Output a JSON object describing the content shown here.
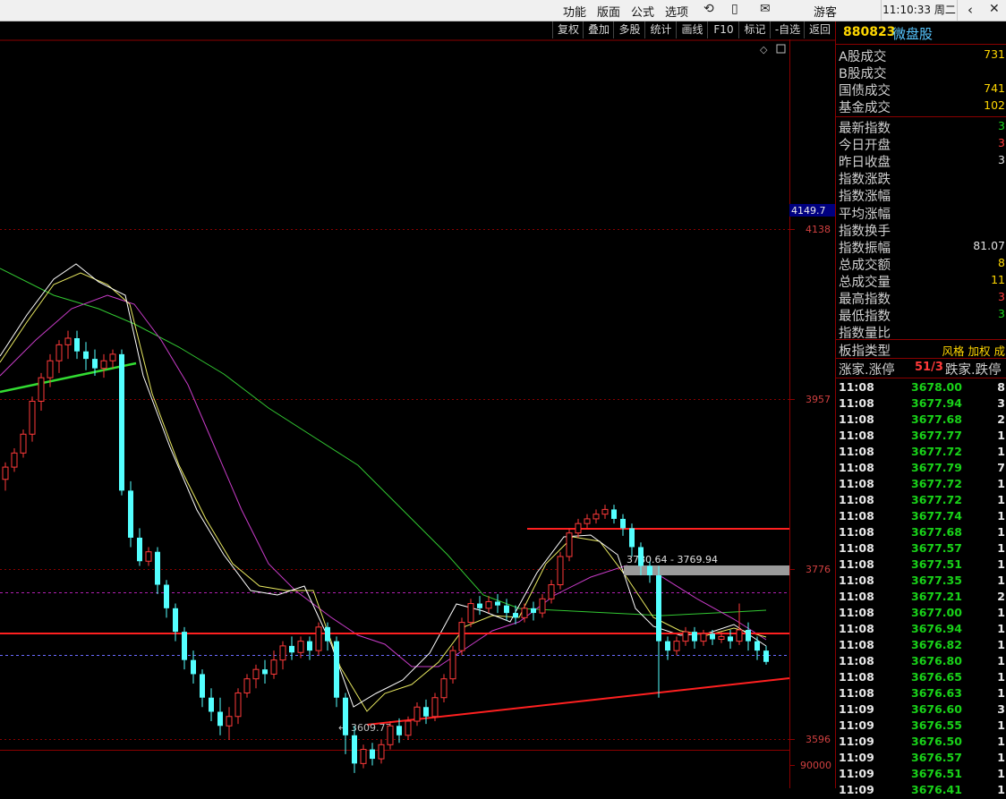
{
  "menu": {
    "items": [
      "功能",
      "版面",
      "公式",
      "选项"
    ],
    "user": "游客",
    "clock": "11:10:33 周二"
  },
  "toolbar": {
    "buttons": [
      "复权",
      "叠加",
      "多股",
      "统计",
      "画线",
      "F10",
      "标记",
      "-自选",
      "返回"
    ]
  },
  "chart_data": {
    "type": "candlestick",
    "y_ticks": [
      "4138",
      "3957",
      "3776",
      "3596"
    ],
    "volume_tick": "90000",
    "price_tag": "4149.7",
    "annotations": {
      "range_label": "3780.64 - 3769.94",
      "low_label": "3609.77"
    },
    "candles": [
      [
        3872,
        3885,
        3860,
        3890
      ],
      [
        3885,
        3900,
        3880,
        3905
      ],
      [
        3900,
        3920,
        3895,
        3925
      ],
      [
        3920,
        3955,
        3912,
        3960
      ],
      [
        3955,
        3980,
        3945,
        3985
      ],
      [
        3980,
        3998,
        3970,
        4005
      ],
      [
        3998,
        4015,
        3985,
        4020
      ],
      [
        4015,
        4022,
        4000,
        4030
      ],
      [
        4022,
        4008,
        4000,
        4030
      ],
      [
        4008,
        4000,
        3988,
        4018
      ],
      [
        4000,
        3990,
        3982,
        4010
      ],
      [
        3990,
        3998,
        3980,
        4005
      ],
      [
        3998,
        4005,
        3990,
        4010
      ],
      [
        4005,
        3860,
        3855,
        4010
      ],
      [
        3860,
        3810,
        3800,
        3870
      ],
      [
        3810,
        3785,
        3780,
        3820
      ],
      [
        3785,
        3795,
        3780,
        3800
      ],
      [
        3795,
        3760,
        3750,
        3800
      ],
      [
        3760,
        3735,
        3725,
        3765
      ],
      [
        3735,
        3710,
        3700,
        3740
      ],
      [
        3710,
        3680,
        3670,
        3715
      ],
      [
        3680,
        3665,
        3655,
        3690
      ],
      [
        3665,
        3640,
        3630,
        3670
      ],
      [
        3640,
        3625,
        3615,
        3650
      ],
      [
        3625,
        3610,
        3600,
        3640
      ],
      [
        3610,
        3620,
        3595,
        3630
      ],
      [
        3620,
        3645,
        3612,
        3650
      ],
      [
        3645,
        3660,
        3640,
        3665
      ],
      [
        3660,
        3670,
        3650,
        3675
      ],
      [
        3670,
        3665,
        3655,
        3680
      ],
      [
        3665,
        3680,
        3660,
        3690
      ],
      [
        3680,
        3695,
        3670,
        3700
      ],
      [
        3695,
        3688,
        3680,
        3705
      ],
      [
        3688,
        3700,
        3682,
        3705
      ],
      [
        3700,
        3690,
        3680,
        3705
      ],
      [
        3690,
        3715,
        3685,
        3720
      ],
      [
        3715,
        3700,
        3690,
        3720
      ],
      [
        3700,
        3640,
        3630,
        3705
      ],
      [
        3640,
        3600,
        3580,
        3645
      ],
      [
        3600,
        3570,
        3560,
        3610
      ],
      [
        3570,
        3585,
        3565,
        3590
      ],
      [
        3585,
        3575,
        3568,
        3592
      ],
      [
        3575,
        3590,
        3570,
        3595
      ],
      [
        3590,
        3610,
        3585,
        3615
      ],
      [
        3610,
        3600,
        3592,
        3618
      ],
      [
        3600,
        3615,
        3595,
        3620
      ],
      [
        3615,
        3630,
        3610,
        3635
      ],
      [
        3630,
        3620,
        3612,
        3638
      ],
      [
        3620,
        3640,
        3615,
        3645
      ],
      [
        3640,
        3660,
        3635,
        3665
      ],
      [
        3660,
        3690,
        3655,
        3695
      ],
      [
        3690,
        3720,
        3685,
        3725
      ],
      [
        3720,
        3740,
        3715,
        3745
      ],
      [
        3740,
        3735,
        3728,
        3748
      ],
      [
        3735,
        3742,
        3730,
        3748
      ],
      [
        3742,
        3738,
        3730,
        3750
      ],
      [
        3738,
        3730,
        3722,
        3745
      ],
      [
        3730,
        3725,
        3718,
        3738
      ],
      [
        3725,
        3735,
        3720,
        3740
      ],
      [
        3735,
        3730,
        3722,
        3742
      ],
      [
        3730,
        3745,
        3725,
        3750
      ],
      [
        3745,
        3760,
        3740,
        3765
      ],
      [
        3760,
        3790,
        3755,
        3795
      ],
      [
        3790,
        3815,
        3785,
        3820
      ],
      [
        3815,
        3825,
        3810,
        3830
      ],
      [
        3825,
        3830,
        3820,
        3835
      ],
      [
        3830,
        3835,
        3825,
        3840
      ],
      [
        3835,
        3840,
        3830,
        3845
      ],
      [
        3840,
        3830,
        3825,
        3845
      ],
      [
        3830,
        3820,
        3812,
        3835
      ],
      [
        3820,
        3800,
        3790,
        3825
      ],
      [
        3800,
        3780,
        3770,
        3805
      ],
      [
        3780,
        3770,
        3762,
        3785
      ],
      [
        3770,
        3700,
        3640,
        3780
      ],
      [
        3700,
        3690,
        3680,
        3705
      ],
      [
        3690,
        3700,
        3685,
        3705
      ],
      [
        3700,
        3710,
        3695,
        3715
      ],
      [
        3710,
        3700,
        3692,
        3715
      ],
      [
        3700,
        3708,
        3695,
        3712
      ],
      [
        3708,
        3702,
        3696,
        3712
      ],
      [
        3702,
        3705,
        3698,
        3710
      ],
      [
        3705,
        3700,
        3692,
        3712
      ],
      [
        3700,
        3712,
        3696,
        3740
      ],
      [
        3712,
        3700,
        3690,
        3720
      ],
      [
        3700,
        3690,
        3680,
        3705
      ],
      [
        3690,
        3678,
        3675,
        3695
      ]
    ]
  },
  "panel": {
    "code": "880823",
    "name": "微盘股",
    "stats1": [
      {
        "label": "A股成交",
        "value": "731",
        "color": "#ffd700"
      },
      {
        "label": "B股成交",
        "value": "",
        "color": "#ffd700"
      },
      {
        "label": "国债成交",
        "value": "741",
        "color": "#ffd700"
      },
      {
        "label": "基金成交",
        "value": "102",
        "color": "#ffd700"
      }
    ],
    "stats2": [
      {
        "label": "最新指数",
        "value": "3",
        "color": "#19d219"
      },
      {
        "label": "今日开盘",
        "value": "3",
        "color": "#ff3a3a"
      },
      {
        "label": "昨日收盘",
        "value": "3",
        "color": "#e0e0e0"
      },
      {
        "label": "指数涨跌",
        "value": "",
        "color": "#19d219"
      },
      {
        "label": "指数涨幅",
        "value": "",
        "color": "#19d219"
      },
      {
        "label": "平均涨幅",
        "value": "",
        "color": "#19d219"
      },
      {
        "label": "指数换手",
        "value": "",
        "color": "#e0e0e0"
      },
      {
        "label": "指数振幅",
        "value": "81.07",
        "color": "#e0e0e0"
      },
      {
        "label": "总成交额",
        "value": "8",
        "color": "#ffd700"
      },
      {
        "label": "总成交量",
        "value": "11",
        "color": "#ffd700"
      },
      {
        "label": "最高指数",
        "value": "3",
        "color": "#ff3a3a"
      },
      {
        "label": "最低指数",
        "value": "3",
        "color": "#19d219"
      },
      {
        "label": "指数量比",
        "value": "",
        "color": "#e0e0e0"
      }
    ],
    "board_type_label": "板指类型",
    "board_type_value": "风格 加权 成",
    "updown_label1": "涨家.涨停",
    "updown_value1": "51/3",
    "updown_label2": "跌家.跌停",
    "ticks": [
      {
        "t": "11:08",
        "p": "3678.00",
        "v": "8"
      },
      {
        "t": "11:08",
        "p": "3677.94",
        "v": "3"
      },
      {
        "t": "11:08",
        "p": "3677.68",
        "v": "2"
      },
      {
        "t": "11:08",
        "p": "3677.77",
        "v": "1"
      },
      {
        "t": "11:08",
        "p": "3677.72",
        "v": "1"
      },
      {
        "t": "11:08",
        "p": "3677.79",
        "v": "7"
      },
      {
        "t": "11:08",
        "p": "3677.72",
        "v": "1"
      },
      {
        "t": "11:08",
        "p": "3677.72",
        "v": "1"
      },
      {
        "t": "11:08",
        "p": "3677.74",
        "v": "1"
      },
      {
        "t": "11:08",
        "p": "3677.68",
        "v": "1"
      },
      {
        "t": "11:08",
        "p": "3677.57",
        "v": "1"
      },
      {
        "t": "11:08",
        "p": "3677.51",
        "v": "1"
      },
      {
        "t": "11:08",
        "p": "3677.35",
        "v": "1"
      },
      {
        "t": "11:08",
        "p": "3677.21",
        "v": "2"
      },
      {
        "t": "11:08",
        "p": "3677.00",
        "v": "1"
      },
      {
        "t": "11:08",
        "p": "3676.94",
        "v": "1"
      },
      {
        "t": "11:08",
        "p": "3676.82",
        "v": "1"
      },
      {
        "t": "11:08",
        "p": "3676.80",
        "v": "1"
      },
      {
        "t": "11:08",
        "p": "3676.65",
        "v": "1"
      },
      {
        "t": "11:08",
        "p": "3676.63",
        "v": "1"
      },
      {
        "t": "11:09",
        "p": "3676.60",
        "v": "3"
      },
      {
        "t": "11:09",
        "p": "3676.55",
        "v": "1"
      },
      {
        "t": "11:09",
        "p": "3676.50",
        "v": "1"
      },
      {
        "t": "11:09",
        "p": "3676.57",
        "v": "1"
      },
      {
        "t": "11:09",
        "p": "3676.51",
        "v": "1"
      },
      {
        "t": "11:09",
        "p": "3676.41",
        "v": "1"
      }
    ]
  }
}
